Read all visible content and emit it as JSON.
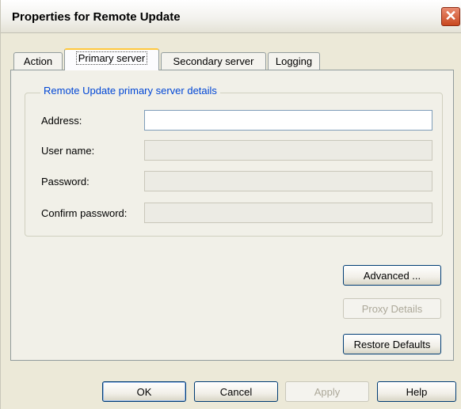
{
  "window": {
    "title": "Properties for Remote Update"
  },
  "tabs": [
    {
      "label": "Action"
    },
    {
      "label": "Primary server"
    },
    {
      "label": "Secondary server"
    },
    {
      "label": "Logging"
    }
  ],
  "group": {
    "title": "Remote Update primary server details",
    "fields": [
      {
        "label": "Address:",
        "value": "",
        "disabled": false
      },
      {
        "label": "User name:",
        "value": "",
        "disabled": true
      },
      {
        "label": "Password:",
        "value": "",
        "disabled": true
      },
      {
        "label": "Confirm password:",
        "value": "",
        "disabled": true
      }
    ]
  },
  "side_buttons": {
    "advanced": "Advanced ...",
    "proxy": "Proxy Details",
    "restore": "Restore Defaults"
  },
  "footer_buttons": {
    "ok": "OK",
    "cancel": "Cancel",
    "apply": "Apply",
    "help": "Help"
  },
  "icons": {
    "close": "close-icon"
  }
}
